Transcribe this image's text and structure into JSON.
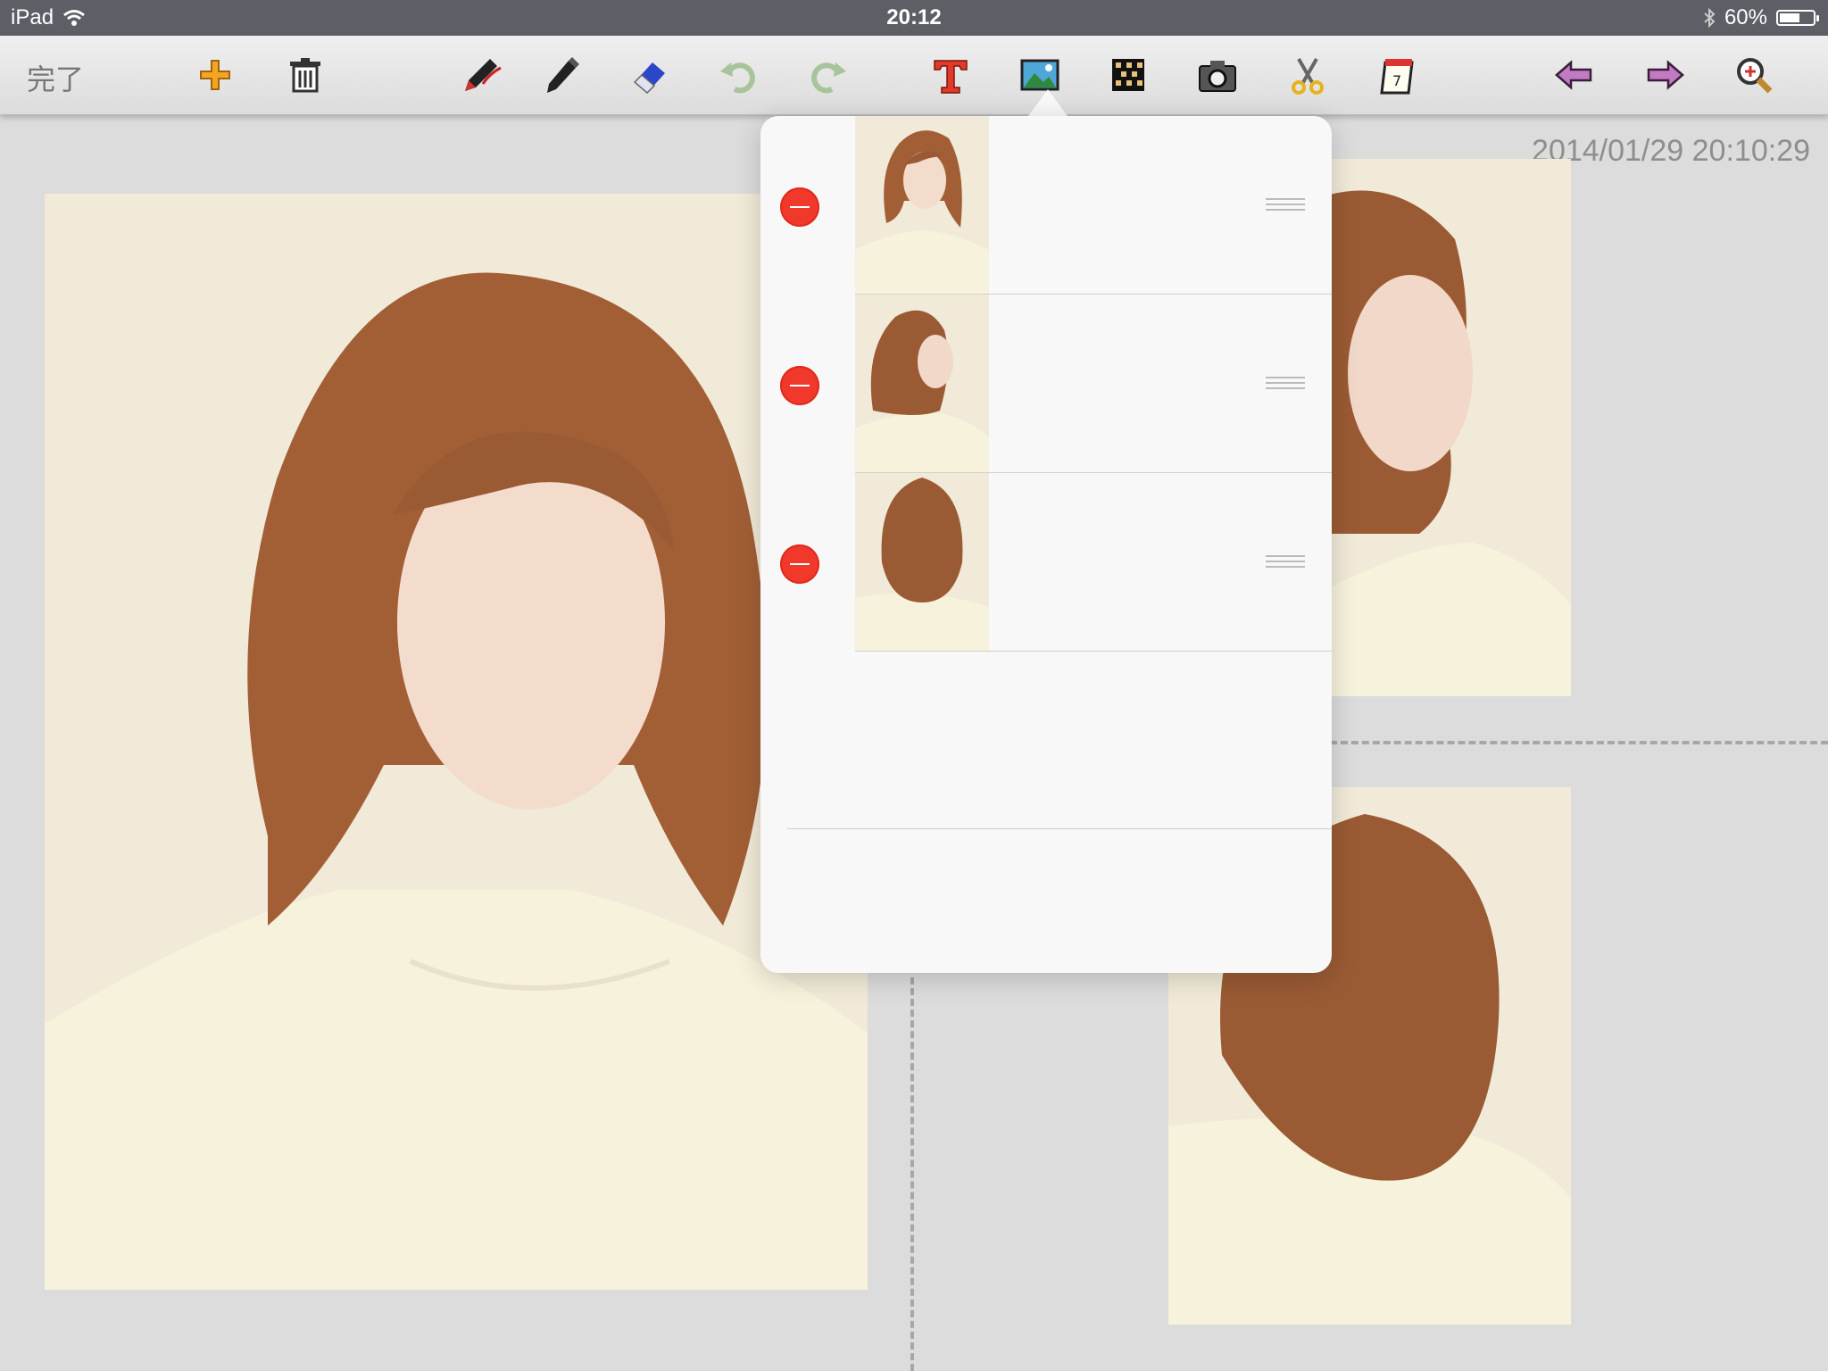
{
  "status_bar": {
    "device": "iPad",
    "time": "20:12",
    "battery_percent": "60%",
    "battery_level": 0.6
  },
  "toolbar": {
    "done_label": "完了",
    "icons": [
      "add-icon",
      "trash-icon",
      "pen-icon",
      "marker-icon",
      "eraser-icon",
      "undo-icon",
      "redo-icon",
      "text-icon",
      "image-icon",
      "pattern-icon",
      "camera-icon",
      "scissors-icon",
      "calendar-icon",
      "prev-page-icon",
      "next-page-icon",
      "zoom-icon"
    ]
  },
  "canvas": {
    "timestamp": "2014/01/29 20:10:29"
  },
  "image_list": {
    "items": [
      {
        "pose": "front"
      },
      {
        "pose": "side"
      },
      {
        "pose": "back"
      }
    ]
  },
  "colors": {
    "status_bar": "#5c5f66",
    "delete_red": "#f0392b",
    "hair": "#9a5a34",
    "background": "#f1ead8"
  }
}
